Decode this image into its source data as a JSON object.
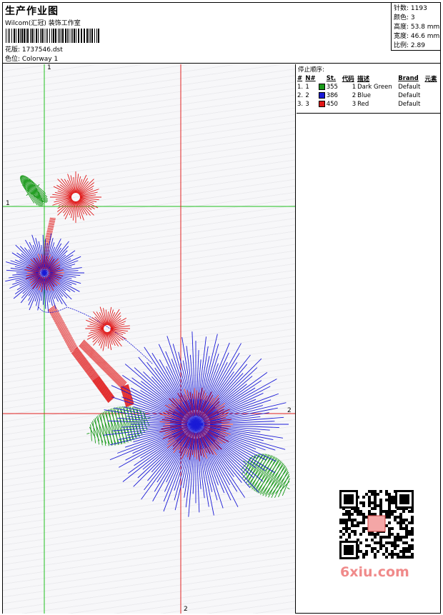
{
  "header": {
    "title": "生产作业图",
    "subtitle": "Wilcom(汇冠) 装饰工作室",
    "design_line": "花版: 1737546.dst",
    "colorway_line": "色位: Colorway 1"
  },
  "stats": {
    "stitches": "针数: 1193",
    "colors": "颜色: 3",
    "height": "高度: 53.8 mm",
    "width": "宽度: 46.6 mm",
    "scale": "比例: 2.89"
  },
  "stop_sequence": {
    "title": "停止顺序:",
    "headers": [
      "#",
      "N#",
      "St.",
      "代码",
      "描述",
      "Brand",
      "元素"
    ],
    "rows": [
      {
        "idx": "1.",
        "n": "1",
        "color": "#1a9a1a",
        "st": "355",
        "code": "1",
        "desc": "Dark Green",
        "brand": "Default"
      },
      {
        "idx": "2.",
        "n": "2",
        "color": "#1a1ad6",
        "st": "386",
        "code": "2",
        "desc": "Blue",
        "brand": "Default"
      },
      {
        "idx": "3.",
        "n": "3",
        "color": "#e01818",
        "st": "450",
        "code": "3",
        "desc": "Red",
        "brand": "Default"
      }
    ]
  },
  "axes": {
    "v1_top": "1",
    "h1_left": "1",
    "h2_right": "2",
    "v2_bottom": "2"
  },
  "watermark": {
    "site": "6xiu.com"
  }
}
